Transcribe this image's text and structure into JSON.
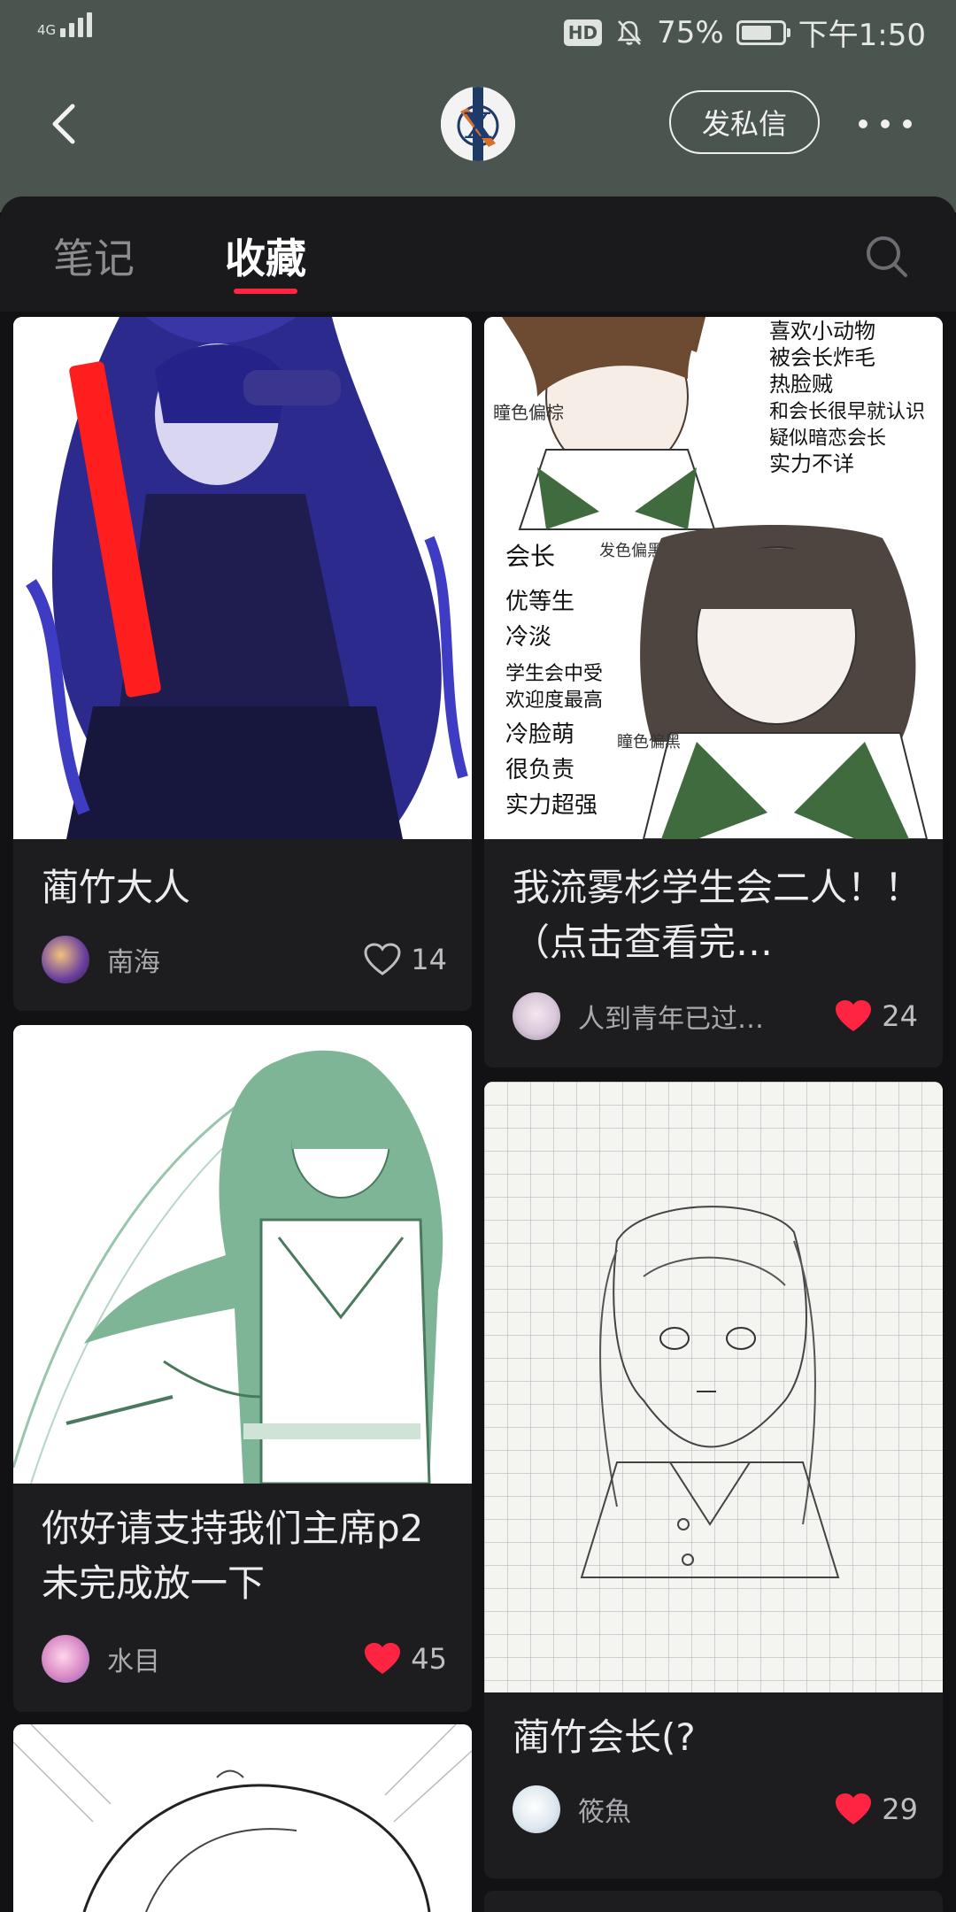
{
  "status_bar": {
    "network": "4G",
    "hd": "HD",
    "battery": "75%",
    "battery_level": 0.75,
    "time": "下午1:50"
  },
  "top_bar": {
    "avatar_logo_letter": "X",
    "dm_button": "发私信"
  },
  "tabs": [
    {
      "label": "笔记",
      "active": false
    },
    {
      "label": "收藏",
      "active": true
    }
  ],
  "colors": {
    "accent": "#ff2442",
    "header_bg": "#4a5550",
    "card_bg": "#1d1d20"
  },
  "cards": [
    {
      "title": "蔺竹大人",
      "author": "南海",
      "likes": "14",
      "liked": false
    },
    {
      "title": "我流雾杉学生会二人！！（点击查看完…",
      "author": "人到青年已过…",
      "likes": "24",
      "liked": true
    },
    {
      "title": "你好请支持我们主席p2未完成放一下",
      "author": "水目",
      "likes": "45",
      "liked": true
    },
    {
      "title": "蔺竹会长(?",
      "author": "筱魚",
      "likes": "29",
      "liked": true
    }
  ],
  "sketch_text": {
    "top_notes": [
      "喜欢小动物",
      "被会长炸毛",
      "热脸贼",
      "和会长很早就认识",
      "疑似暗恋会长",
      "实力不详"
    ],
    "eye_note_top": "瞳色偏棕",
    "hair_note": "发色偏黑",
    "bottom_notes": [
      "会长",
      "优等生",
      "冷淡",
      "学生会中受",
      "欢迎度最高",
      "冷脸萌",
      "很负责",
      "实力超强"
    ],
    "eye_note_bottom": "瞳色偏黑"
  }
}
